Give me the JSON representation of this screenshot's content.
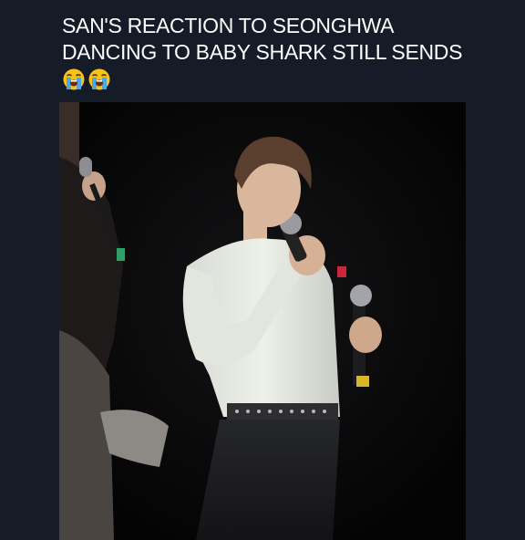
{
  "post": {
    "caption_line1": "SAN'S REACTION TO SEONGHWA",
    "caption_line2": "DANCING TO BABY SHARK STILL SENDS",
    "emojis": [
      "loudly-crying-face-emoji",
      "loudly-crying-face-emoji"
    ]
  },
  "media": {
    "type": "video-frame",
    "subject": "performer-holding-microphone"
  },
  "colors": {
    "background": "#151c27",
    "caption_text": "#ffffff",
    "video_background": "#060607",
    "emoji_face": "#f8c21d",
    "emoji_tears": "#4aa8e8"
  }
}
